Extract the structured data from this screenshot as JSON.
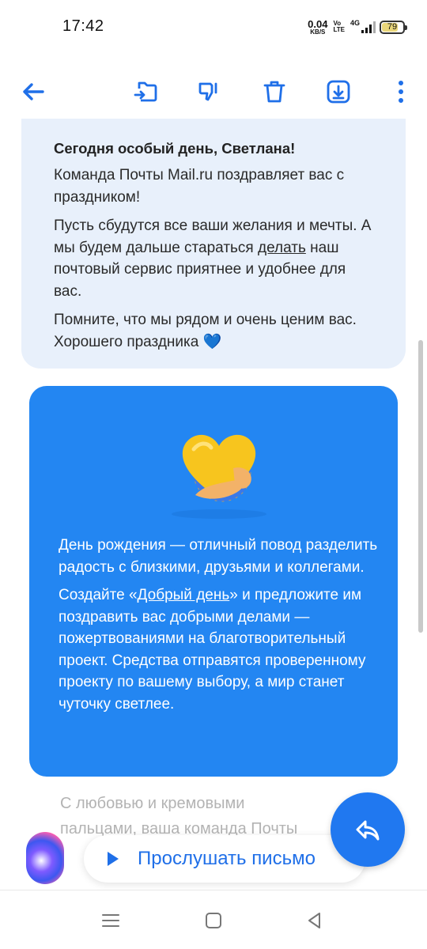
{
  "status": {
    "time": "17:42",
    "net_speed": "0.04",
    "net_unit": "KB/S",
    "volte_top": "Vo",
    "volte_bottom": "LTE",
    "network": "4G",
    "battery": "79"
  },
  "toolbar": {
    "icons": [
      "back-arrow-icon",
      "move-to-folder-icon",
      "mark-spam-icon",
      "trash-icon",
      "download-icon",
      "more-vertical-icon"
    ]
  },
  "email": {
    "greeting_heading": "Сегодня особый день, Светлана!",
    "para1": "Команда Почты Mail.ru поздравляет вас с праздником!",
    "para2_before": "Пусть сбудутся все ваши желания и мечты. А мы будем дальше стараться ",
    "para2_link": "делать",
    "para2_after": " наш почтовый сервис приятнее и удобнее для вас.",
    "para3": "Помните, что мы рядом и очень ценим вас. Хорошего праздника 💙",
    "card_para1": "День рождения — отличный повод разделить радость с близкими, друзьями и коллегами.",
    "card_para2_before": "Создайте «",
    "card_para2_link": "Добрый день",
    "card_para2_after": "» и предложите им поздравить вас добрыми делами — пожертвованиями на благотворительный проект. Средства отправятся проверенному проекту по вашему выбору, а мир станет чуточку светлее.",
    "signoff": "С любовью и кремовыми пальцами, ваша команда Почты"
  },
  "listen": {
    "label": "Прослушать письмо"
  },
  "colors": {
    "accent": "#1f6fe8",
    "card_blue": "#2386f2",
    "greet_bg": "#e8f0fb"
  }
}
